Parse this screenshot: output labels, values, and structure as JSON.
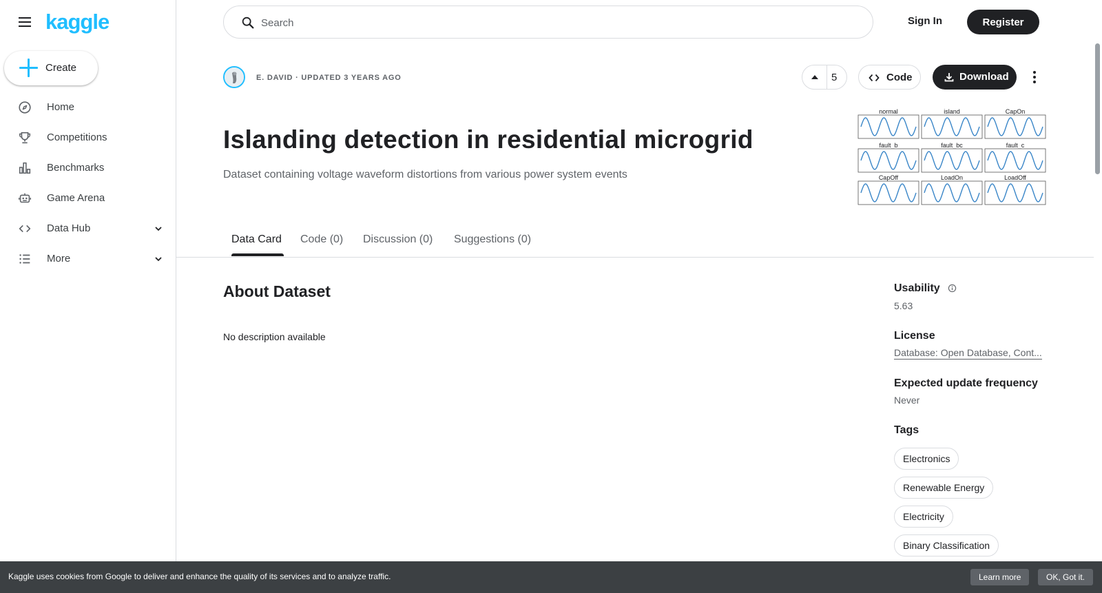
{
  "brand": {
    "logo_text": "kaggle",
    "accent": "#20beff"
  },
  "sidebar": {
    "create_label": "Create",
    "items": [
      {
        "label": "Home",
        "icon": "compass-icon"
      },
      {
        "label": "Competitions",
        "icon": "trophy-icon"
      },
      {
        "label": "Benchmarks",
        "icon": "bar-chart-icon"
      },
      {
        "label": "Game Arena",
        "icon": "robot-icon"
      },
      {
        "label": "Data Hub",
        "icon": "code-brackets-icon",
        "expandable": true
      },
      {
        "label": "More",
        "icon": "list-icon",
        "expandable": true
      }
    ]
  },
  "header": {
    "search_placeholder": "Search",
    "signin_label": "Sign In",
    "register_label": "Register"
  },
  "dataset": {
    "meta": "E. David · Updated 3 years ago",
    "votes": "5",
    "code_label": "Code",
    "download_label": "Download",
    "title": "Islanding detection in residential microgrid",
    "subtitle": "Dataset containing voltage waveform distortions from various power system events",
    "thumbnail_panels": [
      "normal",
      "island",
      "CapOn",
      "fault_b",
      "fault_bc",
      "fault_c",
      "CapOff",
      "LoadOn",
      "LoadOff"
    ]
  },
  "tabs": [
    {
      "label": "Data Card",
      "active": true
    },
    {
      "label": "Code (0)",
      "active": false
    },
    {
      "label": "Discussion (0)",
      "active": false
    },
    {
      "label": "Suggestions (0)",
      "active": false
    }
  ],
  "about": {
    "heading": "About Dataset",
    "description": "No description available"
  },
  "details": {
    "usability_label": "Usability",
    "usability_value": "5.63",
    "license_label": "License",
    "license_value": "Database: Open Database, Cont...",
    "frequency_label": "Expected update frequency",
    "frequency_value": "Never",
    "tags_label": "Tags",
    "tags": [
      "Electronics",
      "Renewable Energy",
      "Electricity",
      "Binary Classification"
    ]
  },
  "cookie": {
    "text": "Kaggle uses cookies from Google to deliver and enhance the quality of its services and to analyze traffic.",
    "learn_more": "Learn more",
    "ok": "OK, Got it."
  }
}
